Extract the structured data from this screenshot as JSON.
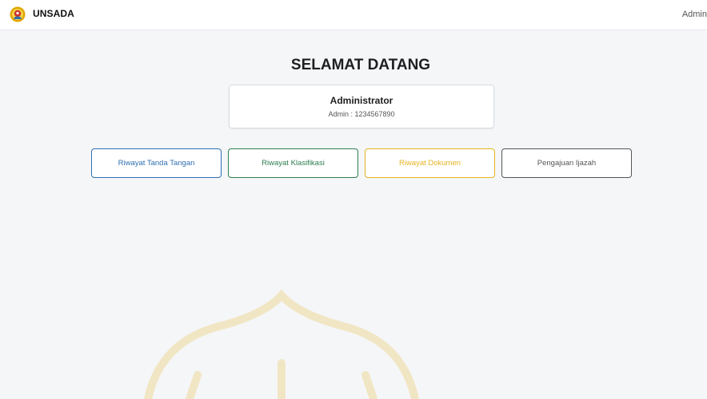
{
  "header": {
    "brand": "UNSADA",
    "user_menu": "Admin",
    "logo_icon": "university-seal-icon"
  },
  "main": {
    "title": "SELAMAT DATANG",
    "profile": {
      "name": "Administrator",
      "subtitle": "Admin : 1234567890"
    },
    "actions": [
      {
        "label": "Riwayat Tanda Tangan",
        "color": "#2f6fb0"
      },
      {
        "label": "Riwayat Klasifikasi",
        "color": "#2e7d4f"
      },
      {
        "label": "Riwayat Dokumen",
        "color": "#e6b422"
      },
      {
        "label": "Pengajuan Ijazah",
        "color": "#555555"
      }
    ]
  },
  "colors": {
    "background": "#f5f6f8",
    "watermark": "#f2ead0"
  }
}
